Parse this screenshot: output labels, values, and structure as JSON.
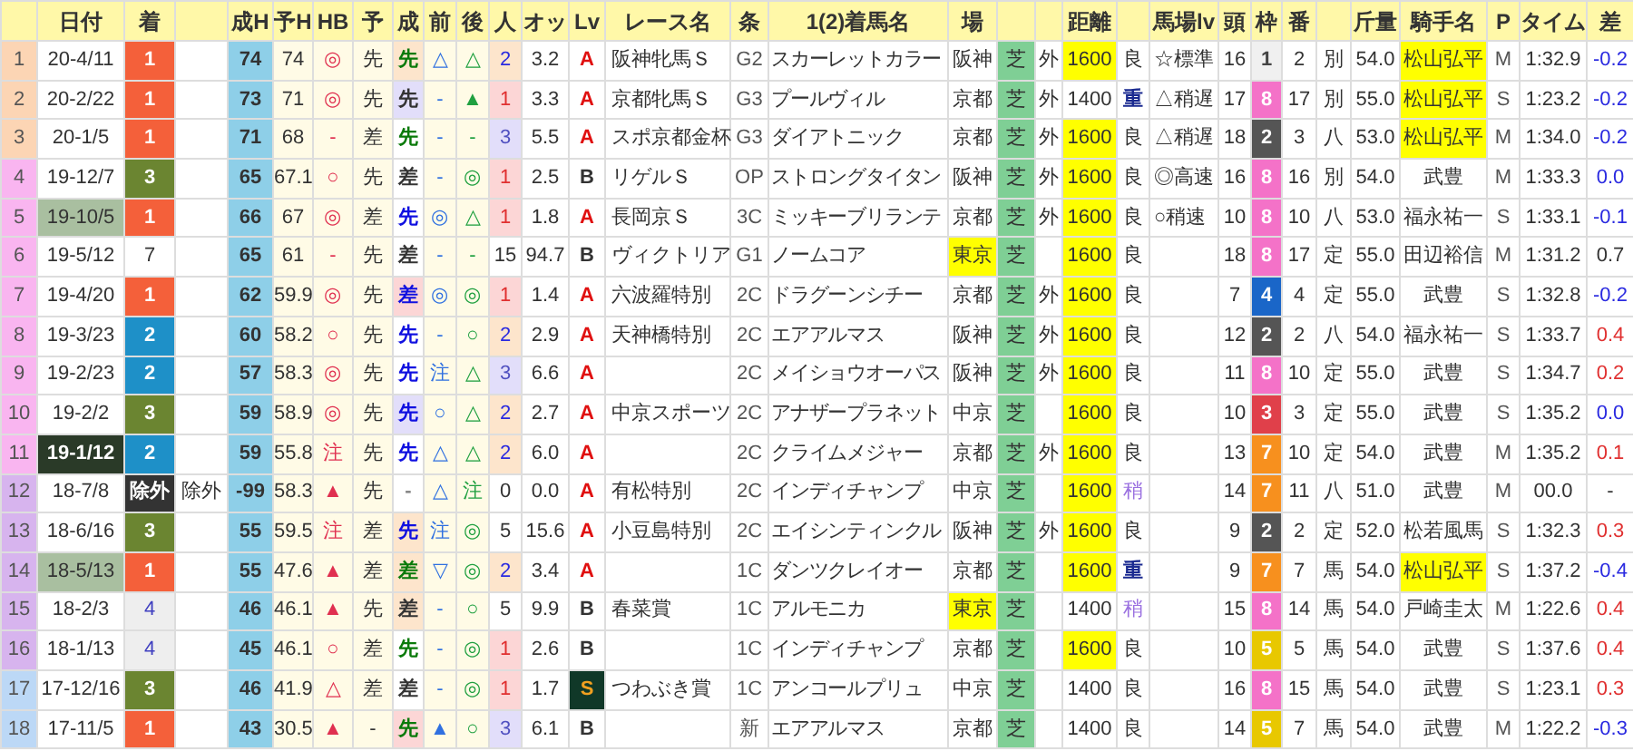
{
  "columns": [
    {},
    {
      "label": "日付"
    },
    {
      "label": "着"
    },
    {},
    {
      "label": "成H"
    },
    {
      "label": "予H"
    },
    {
      "label": "HB"
    },
    {
      "label": "予"
    },
    {
      "label": "成"
    },
    {
      "label": "前"
    },
    {
      "label": "後"
    },
    {
      "label": "人"
    },
    {
      "label": "オッ"
    },
    {
      "label": "Lv"
    },
    {
      "label": "レース名"
    },
    {
      "label": "条"
    },
    {
      "label": "1(2)着馬名"
    },
    {
      "label": "場"
    },
    {},
    {},
    {
      "label": "距離"
    },
    {},
    {
      "label": "馬場lv"
    },
    {
      "label": "頭"
    },
    {
      "label": "枠"
    },
    {
      "label": "番"
    },
    {},
    {
      "label": "斤量"
    },
    {
      "label": "騎手名"
    },
    {
      "label": "P"
    },
    {
      "label": "タイム"
    },
    {
      "label": "差"
    }
  ],
  "rows": [
    {
      "n": "1",
      "color": "#fcd5b4",
      "date": {
        "text": "20-4/11",
        "kind": "plain"
      },
      "finish": {
        "text": "1",
        "kind": "first"
      },
      "seiH": "74",
      "yoH": "74",
      "hb": "◎",
      "yo": "先",
      "sei": {
        "text": "先",
        "color": "#0a7a0a",
        "kind": "peach"
      },
      "mae": "△",
      "ato": "△",
      "pop": {
        "text": "2",
        "color": "#2a2ae0",
        "kind": "peach"
      },
      "odds": "3.2",
      "lv": {
        "text": "A",
        "kind": "a"
      },
      "race": "阪神牝馬Ｓ",
      "grade": "G2",
      "winner": "スカーレットカラー",
      "course": "阪神",
      "course_highlight": false,
      "surface": "芝",
      "side": "外",
      "distance": "1600",
      "distance_highlight": true,
      "going": {
        "text": "良",
        "kind": "good"
      },
      "going_lv": "☆標準",
      "runners": "16",
      "frame": {
        "text": "1",
        "color": "#f0f0f0",
        "kind": "light"
      },
      "number": "2",
      "tag": "別",
      "weight": "54.0",
      "jockey": "松山弘平",
      "jockey_highlight": true,
      "pace": "M",
      "time": "1:32.9",
      "diff": {
        "text": "-0.2",
        "color": "#2a2ae0"
      }
    },
    {
      "n": "2",
      "color": "#fcd5b4",
      "date": {
        "text": "20-2/22",
        "kind": "plain"
      },
      "finish": {
        "text": "1",
        "kind": "first"
      },
      "seiH": "73",
      "yoH": "71",
      "hb": "◎",
      "yo": "先",
      "sei": {
        "text": "先",
        "color": "#333333",
        "kind": "lavender"
      },
      "mae": "-",
      "ato": "▲",
      "pop": {
        "text": "1",
        "color": "#e03030",
        "kind": "pink"
      },
      "odds": "3.3",
      "lv": {
        "text": "A",
        "kind": "a"
      },
      "race": "京都牝馬Ｓ",
      "grade": "G3",
      "winner": "プールヴィル",
      "course": "京都",
      "course_highlight": false,
      "surface": "芝",
      "side": "外",
      "distance": "1400",
      "distance_highlight": false,
      "going": {
        "text": "重",
        "kind": "heavy"
      },
      "going_lv": "△稍遅",
      "runners": "17",
      "frame": {
        "text": "8",
        "color": "#f472c8",
        "kind": "solid"
      },
      "number": "17",
      "tag": "別",
      "weight": "55.0",
      "jockey": "松山弘平",
      "jockey_highlight": true,
      "pace": "S",
      "time": "1:23.2",
      "diff": {
        "text": "-0.2",
        "color": "#2a2ae0"
      }
    },
    {
      "n": "3",
      "color": "#fcd5b4",
      "date": {
        "text": "20-1/5",
        "kind": "plain"
      },
      "finish": {
        "text": "1",
        "kind": "first"
      },
      "seiH": "71",
      "yoH": "68",
      "hb": "-",
      "yo": "差",
      "sei": {
        "text": "先",
        "color": "#0a7a0a",
        "kind": "plain"
      },
      "mae": "-",
      "ato": "-",
      "pop": {
        "text": "3",
        "color": "#5050c0",
        "kind": "lavender"
      },
      "odds": "5.5",
      "lv": {
        "text": "A",
        "kind": "a"
      },
      "race": "スポ京都金杯",
      "grade": "G3",
      "winner": "ダイアトニック",
      "course": "京都",
      "course_highlight": false,
      "surface": "芝",
      "side": "外",
      "distance": "1600",
      "distance_highlight": true,
      "going": {
        "text": "良",
        "kind": "good"
      },
      "going_lv": "△稍遅",
      "runners": "18",
      "frame": {
        "text": "2",
        "color": "#555555",
        "kind": "solid"
      },
      "number": "3",
      "tag": "八",
      "weight": "53.0",
      "jockey": "松山弘平",
      "jockey_highlight": true,
      "pace": "M",
      "time": "1:34.0",
      "diff": {
        "text": "-0.2",
        "color": "#2a2ae0"
      }
    },
    {
      "n": "4",
      "color": "#f9b5f0",
      "date": {
        "text": "19-12/7",
        "kind": "plain"
      },
      "finish": {
        "text": "3",
        "kind": "third"
      },
      "seiH": "65",
      "yoH": "67.1",
      "hb": "○",
      "yo": "先",
      "sei": {
        "text": "差",
        "color": "#333333",
        "kind": "plain"
      },
      "mae": "-",
      "ato": "◎",
      "pop": {
        "text": "1",
        "color": "#e03030",
        "kind": "pink"
      },
      "odds": "2.5",
      "lv": {
        "text": "B",
        "kind": "b"
      },
      "race": "リゲルＳ",
      "grade": "OP",
      "winner": "ストロングタイタン",
      "course": "阪神",
      "course_highlight": false,
      "surface": "芝",
      "side": "外",
      "distance": "1600",
      "distance_highlight": true,
      "going": {
        "text": "良",
        "kind": "good"
      },
      "going_lv": "◎高速",
      "runners": "16",
      "frame": {
        "text": "8",
        "color": "#f472c8",
        "kind": "solid"
      },
      "number": "16",
      "tag": "別",
      "weight": "54.0",
      "jockey": "武豊",
      "jockey_highlight": false,
      "pace": "M",
      "time": "1:33.3",
      "diff": {
        "text": "0.0",
        "color": "#2a2ae0"
      }
    },
    {
      "n": "5",
      "color": "#f9b5f0",
      "date": {
        "text": "19-10/5",
        "kind": "light"
      },
      "finish": {
        "text": "1",
        "kind": "first"
      },
      "seiH": "66",
      "yoH": "67",
      "hb": "◎",
      "yo": "差",
      "sei": {
        "text": "先",
        "color": "#1010e0",
        "kind": "plain"
      },
      "mae": "◎",
      "ato": "△",
      "pop": {
        "text": "1",
        "color": "#e03030",
        "kind": "pink"
      },
      "odds": "1.8",
      "lv": {
        "text": "A",
        "kind": "a"
      },
      "race": "長岡京Ｓ",
      "grade": "3C",
      "winner": "ミッキーブリランテ",
      "course": "京都",
      "course_highlight": false,
      "surface": "芝",
      "side": "外",
      "distance": "1600",
      "distance_highlight": true,
      "going": {
        "text": "良",
        "kind": "good"
      },
      "going_lv": "○稍速",
      "runners": "10",
      "frame": {
        "text": "8",
        "color": "#f472c8",
        "kind": "solid"
      },
      "number": "10",
      "tag": "八",
      "weight": "53.0",
      "jockey": "福永祐一",
      "jockey_highlight": false,
      "pace": "S",
      "time": "1:33.1",
      "diff": {
        "text": "-0.1",
        "color": "#2a2ae0"
      }
    },
    {
      "n": "6",
      "color": "#f9b5f0",
      "date": {
        "text": "19-5/12",
        "kind": "plain"
      },
      "finish": {
        "text": "7",
        "kind": "other"
      },
      "seiH": "65",
      "yoH": "61",
      "hb": "-",
      "yo": "先",
      "sei": {
        "text": "差",
        "color": "#333333",
        "kind": "plain"
      },
      "mae": "-",
      "ato": "-",
      "pop": {
        "text": "15",
        "color": "#333333",
        "kind": "plain"
      },
      "odds": "94.7",
      "lv": {
        "text": "B",
        "kind": "b"
      },
      "race": "ヴィクトリア",
      "grade": "G1",
      "winner": "ノームコア",
      "course": "東京",
      "course_highlight": true,
      "surface": "芝",
      "distance": "1600",
      "distance_highlight": true,
      "going": {
        "text": "良",
        "kind": "good"
      },
      "runners": "18",
      "frame": {
        "text": "8",
        "color": "#f472c8",
        "kind": "solid"
      },
      "number": "17",
      "tag": "定",
      "weight": "55.0",
      "jockey": "田辺裕信",
      "jockey_highlight": false,
      "pace": "M",
      "time": "1:31.2",
      "diff": {
        "text": "0.7",
        "color": "#333333"
      }
    },
    {
      "n": "7",
      "color": "#f9b5f0",
      "date": {
        "text": "19-4/20",
        "kind": "plain"
      },
      "finish": {
        "text": "1",
        "kind": "first"
      },
      "seiH": "62",
      "yoH": "59.9",
      "hb": "◎",
      "yo": "先",
      "sei": {
        "text": "差",
        "color": "#1010e0",
        "kind": "pink"
      },
      "mae": "◎",
      "ato": "◎",
      "pop": {
        "text": "1",
        "color": "#e03030",
        "kind": "pink"
      },
      "odds": "1.4",
      "lv": {
        "text": "A",
        "kind": "a"
      },
      "race": "六波羅特別",
      "grade": "2C",
      "winner": "ドラグーンシチー",
      "course": "京都",
      "course_highlight": false,
      "surface": "芝",
      "side": "外",
      "distance": "1600",
      "distance_highlight": true,
      "going": {
        "text": "良",
        "kind": "good"
      },
      "runners": "7",
      "frame": {
        "text": "4",
        "color": "#1a66c8",
        "kind": "solid"
      },
      "number": "4",
      "tag": "定",
      "weight": "55.0",
      "jockey": "武豊",
      "jockey_highlight": false,
      "pace": "S",
      "time": "1:32.8",
      "diff": {
        "text": "-0.2",
        "color": "#2a2ae0"
      }
    },
    {
      "n": "8",
      "color": "#f9b5f0",
      "date": {
        "text": "19-3/23",
        "kind": "plain"
      },
      "finish": {
        "text": "2",
        "kind": "second"
      },
      "seiH": "60",
      "yoH": "58.2",
      "hb": "○",
      "yo": "先",
      "sei": {
        "text": "先",
        "color": "#1010e0",
        "kind": "plain"
      },
      "mae": "-",
      "ato": "○",
      "pop": {
        "text": "2",
        "color": "#2a2ae0",
        "kind": "peach"
      },
      "odds": "2.9",
      "lv": {
        "text": "A",
        "kind": "a"
      },
      "race": "天神橋特別",
      "grade": "2C",
      "winner": "エアアルマス",
      "course": "阪神",
      "course_highlight": false,
      "surface": "芝",
      "side": "外",
      "distance": "1600",
      "distance_highlight": true,
      "going": {
        "text": "良",
        "kind": "good"
      },
      "runners": "12",
      "frame": {
        "text": "2",
        "color": "#555555",
        "kind": "solid"
      },
      "number": "2",
      "tag": "八",
      "weight": "54.0",
      "jockey": "福永祐一",
      "jockey_highlight": false,
      "pace": "S",
      "time": "1:33.7",
      "diff": {
        "text": "0.4",
        "color": "#e03030"
      }
    },
    {
      "n": "9",
      "color": "#f9b5f0",
      "date": {
        "text": "19-2/23",
        "kind": "plain"
      },
      "finish": {
        "text": "2",
        "kind": "second"
      },
      "seiH": "57",
      "yoH": "58.3",
      "hb": "◎",
      "yo": "先",
      "sei": {
        "text": "先",
        "color": "#1010e0",
        "kind": "plain"
      },
      "mae": "注",
      "ato": "△",
      "pop": {
        "text": "3",
        "color": "#5050c0",
        "kind": "lavender"
      },
      "odds": "6.6",
      "lv": {
        "text": "A",
        "kind": "a"
      },
      "grade": "2C",
      "winner": "メイショウオーパス",
      "course": "阪神",
      "course_highlight": false,
      "surface": "芝",
      "side": "外",
      "distance": "1600",
      "distance_highlight": true,
      "going": {
        "text": "良",
        "kind": "good"
      },
      "runners": "11",
      "frame": {
        "text": "8",
        "color": "#f472c8",
        "kind": "solid"
      },
      "number": "10",
      "tag": "定",
      "weight": "55.0",
      "jockey": "武豊",
      "jockey_highlight": false,
      "pace": "S",
      "time": "1:34.7",
      "diff": {
        "text": "0.2",
        "color": "#e03030"
      }
    },
    {
      "n": "10",
      "color": "#f9b5f0",
      "date": {
        "text": "19-2/2",
        "kind": "plain"
      },
      "finish": {
        "text": "3",
        "kind": "third"
      },
      "seiH": "59",
      "yoH": "58.9",
      "hb": "◎",
      "yo": "先",
      "sei": {
        "text": "先",
        "color": "#1010e0",
        "kind": "lavender"
      },
      "mae": "○",
      "ato": "△",
      "pop": {
        "text": "2",
        "color": "#2a2ae0",
        "kind": "peach"
      },
      "odds": "2.7",
      "lv": {
        "text": "A",
        "kind": "a"
      },
      "race": "中京スポーツ",
      "grade": "2C",
      "winner": "アナザープラネット",
      "course": "中京",
      "course_highlight": false,
      "surface": "芝",
      "distance": "1600",
      "distance_highlight": true,
      "going": {
        "text": "良",
        "kind": "good"
      },
      "runners": "10",
      "frame": {
        "text": "3",
        "color": "#e0404a",
        "kind": "solid"
      },
      "number": "3",
      "tag": "定",
      "weight": "55.0",
      "jockey": "武豊",
      "jockey_highlight": false,
      "pace": "S",
      "time": "1:35.2",
      "diff": {
        "text": "0.0",
        "color": "#2a2ae0"
      }
    },
    {
      "n": "11",
      "color": "#f9b5f0",
      "date": {
        "text": "19-1/12",
        "kind": "dark"
      },
      "finish": {
        "text": "2",
        "kind": "second"
      },
      "seiH": "59",
      "yoH": "55.8",
      "hb": "注",
      "yo": "先",
      "sei": {
        "text": "先",
        "color": "#1010e0",
        "kind": "plain"
      },
      "mae": "△",
      "ato": "△",
      "pop": {
        "text": "2",
        "color": "#2a2ae0",
        "kind": "peach"
      },
      "odds": "6.0",
      "lv": {
        "text": "A",
        "kind": "a"
      },
      "grade": "2C",
      "winner": "クライムメジャー",
      "course": "京都",
      "course_highlight": false,
      "surface": "芝",
      "side": "外",
      "distance": "1600",
      "distance_highlight": true,
      "going": {
        "text": "良",
        "kind": "good"
      },
      "runners": "13",
      "frame": {
        "text": "7",
        "color": "#f7901e",
        "kind": "solid"
      },
      "number": "10",
      "tag": "定",
      "weight": "54.0",
      "jockey": "武豊",
      "jockey_highlight": false,
      "pace": "M",
      "time": "1:35.2",
      "diff": {
        "text": "0.1",
        "color": "#e03030"
      }
    },
    {
      "n": "12",
      "color": "#d7b4ee",
      "date": {
        "text": "18-7/8",
        "kind": "plain"
      },
      "finish": {
        "text": "除外",
        "kind": "out"
      },
      "column_4": "除外",
      "seiH": "-99",
      "yoH": "58.3",
      "hb": "▲",
      "yo": "先",
      "sei": {
        "text": "-",
        "color": "#888888",
        "kind": "plain"
      },
      "mae": "△",
      "ato": "注",
      "pop": {
        "text": "0",
        "color": "#333333",
        "kind": "plain"
      },
      "odds": "0.0",
      "lv": {
        "text": "A",
        "kind": "a"
      },
      "race": "有松特別",
      "grade": "2C",
      "winner": "インディチャンプ",
      "course": "中京",
      "course_highlight": false,
      "surface": "芝",
      "distance": "1600",
      "distance_highlight": true,
      "going": {
        "text": "稍",
        "kind": "soft"
      },
      "runners": "14",
      "frame": {
        "text": "7",
        "color": "#f7901e",
        "kind": "solid"
      },
      "number": "11",
      "tag": "八",
      "weight": "51.0",
      "jockey": "武豊",
      "jockey_highlight": false,
      "pace": "M",
      "time": "00.0",
      "diff": {
        "text": "-",
        "color": "#333333"
      }
    },
    {
      "n": "13",
      "color": "#d7b4ee",
      "date": {
        "text": "18-6/16",
        "kind": "plain"
      },
      "finish": {
        "text": "3",
        "kind": "third"
      },
      "seiH": "55",
      "yoH": "59.5",
      "hb": "注",
      "yo": "差",
      "sei": {
        "text": "先",
        "color": "#1010e0",
        "kind": "peach"
      },
      "mae": "注",
      "ato": "◎",
      "pop": {
        "text": "5",
        "color": "#333333",
        "kind": "plain"
      },
      "odds": "15.6",
      "lv": {
        "text": "A",
        "kind": "a"
      },
      "race": "小豆島特別",
      "grade": "2C",
      "winner": "エイシンティンクル",
      "course": "阪神",
      "course_highlight": false,
      "surface": "芝",
      "side": "外",
      "distance": "1600",
      "distance_highlight": true,
      "going": {
        "text": "良",
        "kind": "good"
      },
      "runners": "9",
      "frame": {
        "text": "2",
        "color": "#555555",
        "kind": "solid"
      },
      "number": "2",
      "tag": "定",
      "weight": "52.0",
      "jockey": "松若風馬",
      "jockey_highlight": false,
      "pace": "S",
      "time": "1:32.3",
      "diff": {
        "text": "0.3",
        "color": "#e03030"
      }
    },
    {
      "n": "14",
      "color": "#d7b4ee",
      "date": {
        "text": "18-5/13",
        "kind": "light"
      },
      "finish": {
        "text": "1",
        "kind": "first"
      },
      "seiH": "55",
      "yoH": "47.6",
      "hb": "▲",
      "yo": "差",
      "sei": {
        "text": "差",
        "color": "#0a7a0a",
        "kind": "peach"
      },
      "mae": "▽",
      "ato": "◎",
      "pop": {
        "text": "2",
        "color": "#2a2ae0",
        "kind": "peach"
      },
      "odds": "3.4",
      "lv": {
        "text": "A",
        "kind": "a"
      },
      "grade": "1C",
      "winner": "ダンツクレイオー",
      "course": "京都",
      "course_highlight": false,
      "surface": "芝",
      "distance": "1600",
      "distance_highlight": true,
      "going": {
        "text": "重",
        "kind": "heavy"
      },
      "runners": "9",
      "frame": {
        "text": "7",
        "color": "#f7901e",
        "kind": "solid"
      },
      "number": "7",
      "tag": "馬",
      "weight": "54.0",
      "jockey": "松山弘平",
      "jockey_highlight": true,
      "pace": "S",
      "time": "1:37.2",
      "diff": {
        "text": "-0.4",
        "color": "#2a2ae0"
      }
    },
    {
      "n": "15",
      "color": "#d7b4ee",
      "date": {
        "text": "18-2/3",
        "kind": "plain"
      },
      "finish": {
        "text": "4",
        "kind": "fourth"
      },
      "seiH": "46",
      "yoH": "46.1",
      "hb": "▲",
      "yo": "先",
      "sei": {
        "text": "差",
        "color": "#333333",
        "kind": "peach"
      },
      "mae": "-",
      "ato": "○",
      "pop": {
        "text": "5",
        "color": "#333333",
        "kind": "plain"
      },
      "odds": "9.9",
      "lv": {
        "text": "B",
        "kind": "b"
      },
      "race": "春菜賞",
      "grade": "1C",
      "winner": "アルモニカ",
      "course": "東京",
      "course_highlight": true,
      "surface": "芝",
      "distance": "1400",
      "distance_highlight": false,
      "going": {
        "text": "稍",
        "kind": "soft"
      },
      "runners": "15",
      "frame": {
        "text": "8",
        "color": "#f472c8",
        "kind": "solid"
      },
      "number": "14",
      "tag": "馬",
      "weight": "54.0",
      "jockey": "戸崎圭太",
      "jockey_highlight": false,
      "pace": "M",
      "time": "1:22.6",
      "diff": {
        "text": "0.4",
        "color": "#e03030"
      }
    },
    {
      "n": "16",
      "color": "#d7b4ee",
      "date": {
        "text": "18-1/13",
        "kind": "plain"
      },
      "finish": {
        "text": "4",
        "kind": "fourth"
      },
      "seiH": "45",
      "yoH": "46.1",
      "hb": "○",
      "yo": "差",
      "sei": {
        "text": "先",
        "color": "#0a7a0a",
        "kind": "plain"
      },
      "mae": "-",
      "ato": "◎",
      "pop": {
        "text": "1",
        "color": "#e03030",
        "kind": "pink"
      },
      "odds": "2.6",
      "lv": {
        "text": "B",
        "kind": "b"
      },
      "grade": "1C",
      "winner": "インディチャンプ",
      "course": "京都",
      "course_highlight": false,
      "surface": "芝",
      "distance": "1600",
      "distance_highlight": true,
      "going": {
        "text": "良",
        "kind": "good"
      },
      "runners": "10",
      "frame": {
        "text": "5",
        "color": "#e8c800",
        "kind": "solid"
      },
      "number": "5",
      "tag": "馬",
      "weight": "54.0",
      "jockey": "武豊",
      "jockey_highlight": false,
      "pace": "S",
      "time": "1:37.6",
      "diff": {
        "text": "0.4",
        "color": "#e03030"
      }
    },
    {
      "n": "17",
      "color": "#bcd8f6",
      "date": {
        "text": "17-12/16",
        "kind": "plain"
      },
      "finish": {
        "text": "3",
        "kind": "third"
      },
      "seiH": "46",
      "yoH": "41.9",
      "hb": "△",
      "yo": "差",
      "sei": {
        "text": "差",
        "color": "#333333",
        "kind": "plain"
      },
      "mae": "-",
      "ato": "◎",
      "pop": {
        "text": "1",
        "color": "#e03030",
        "kind": "pink"
      },
      "odds": "1.7",
      "lv": {
        "text": "S",
        "kind": "s"
      },
      "race": "つわぶき賞",
      "grade": "1C",
      "winner": "アンコールプリュ",
      "course": "中京",
      "course_highlight": false,
      "surface": "芝",
      "distance": "1400",
      "distance_highlight": false,
      "going": {
        "text": "良",
        "kind": "good"
      },
      "runners": "16",
      "frame": {
        "text": "8",
        "color": "#f472c8",
        "kind": "solid"
      },
      "number": "15",
      "tag": "馬",
      "weight": "54.0",
      "jockey": "武豊",
      "jockey_highlight": false,
      "pace": "S",
      "time": "1:23.1",
      "diff": {
        "text": "0.3",
        "color": "#e03030"
      }
    },
    {
      "n": "18",
      "color": "#bcd8f6",
      "date": {
        "text": "17-11/5",
        "kind": "plain"
      },
      "finish": {
        "text": "1",
        "kind": "first"
      },
      "seiH": "43",
      "yoH": "30.5",
      "hb": "▲",
      "yo": "-",
      "sei": {
        "text": "先",
        "color": "#0a7a0a",
        "kind": "pink"
      },
      "mae": "▲",
      "ato": "○",
      "pop": {
        "text": "3",
        "color": "#5050c0",
        "kind": "lavender"
      },
      "odds": "6.1",
      "lv": {
        "text": "B",
        "kind": "b"
      },
      "grade": "新",
      "winner": "エアアルマス",
      "course": "京都",
      "course_highlight": false,
      "surface": "芝",
      "distance": "1400",
      "distance_highlight": false,
      "going": {
        "text": "良",
        "kind": "good"
      },
      "runners": "14",
      "frame": {
        "text": "5",
        "color": "#e8c800",
        "kind": "solid"
      },
      "number": "7",
      "tag": "馬",
      "weight": "54.0",
      "jockey": "武豊",
      "jockey_highlight": false,
      "pace": "M",
      "time": "1:22.2",
      "diff": {
        "text": "-0.3",
        "color": "#2a2ae0"
      }
    }
  ]
}
